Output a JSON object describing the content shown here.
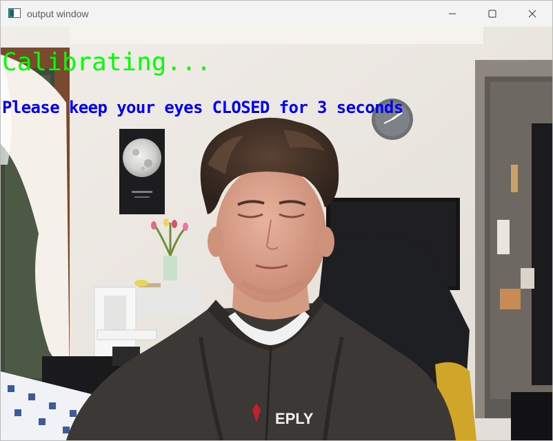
{
  "window": {
    "title": "output window",
    "icon": "app-window-icon",
    "controls": {
      "minimize_icon": "minimize-icon",
      "maximize_icon": "maximize-icon",
      "close_icon": "close-icon"
    }
  },
  "overlay": {
    "status_text": "Calibrating...",
    "status_color": "#00ff00",
    "instruction_text": "Please keep your eyes CLOSED for 3 seconds",
    "instruction_color": "#0000ff"
  },
  "video": {
    "hoodie_logo_text": "EPLY"
  }
}
